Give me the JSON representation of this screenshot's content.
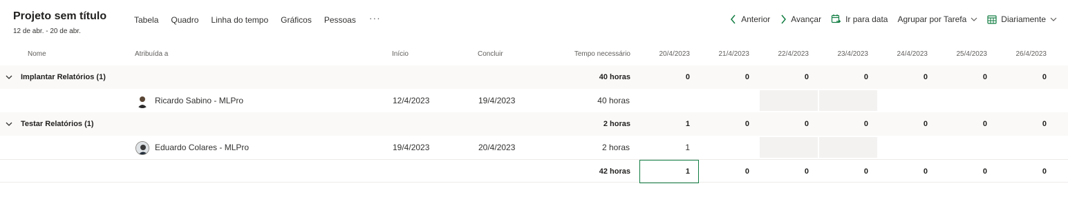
{
  "header": {
    "title": "Projeto sem título",
    "date_range": "12 de abr. - 20 de abr."
  },
  "tabs": [
    {
      "label": "Tabela"
    },
    {
      "label": "Quadro"
    },
    {
      "label": "Linha do tempo"
    },
    {
      "label": "Gráficos"
    },
    {
      "label": "Pessoas"
    }
  ],
  "toolbar": {
    "previous": "Anterior",
    "next": "Avançar",
    "go_to_date": "Ir para data",
    "group_by": "Agrupar por Tarefa",
    "view": "Diariamente"
  },
  "columns": {
    "name": "Nome",
    "assigned": "Atribuída a",
    "start": "Início",
    "finish": "Concluir",
    "time_needed": "Tempo necessário",
    "dates": [
      "20/4/2023",
      "21/4/2023",
      "22/4/2023",
      "23/4/2023",
      "24/4/2023",
      "25/4/2023",
      "26/4/2023"
    ]
  },
  "groups": [
    {
      "name": "Implantar Relatórios (1)",
      "total": "40 horas",
      "days": [
        "0",
        "0",
        "0",
        "0",
        "0",
        "0",
        "0"
      ],
      "assignment": {
        "person": "Ricardo Sabino - MLPro",
        "start": "12/4/2023",
        "finish": "19/4/2023",
        "hours": "40 horas",
        "days": [
          "",
          "",
          "",
          "",
          "",
          "",
          ""
        ]
      }
    },
    {
      "name": "Testar Relatórios (1)",
      "total": "2 horas",
      "days": [
        "1",
        "0",
        "0",
        "0",
        "0",
        "0",
        "0"
      ],
      "assignment": {
        "person": "Eduardo Colares - MLPro",
        "start": "19/4/2023",
        "finish": "20/4/2023",
        "hours": "2 horas",
        "days": [
          "1",
          "",
          "",
          "",
          "",
          "",
          ""
        ]
      }
    }
  ],
  "totals": {
    "hours": "42 horas",
    "days": [
      "1",
      "0",
      "0",
      "0",
      "0",
      "0",
      "0"
    ]
  },
  "colors": {
    "accent": "#107c41",
    "group_bg": "#faf9f8",
    "weekend_shade": "#f3f2f1"
  }
}
